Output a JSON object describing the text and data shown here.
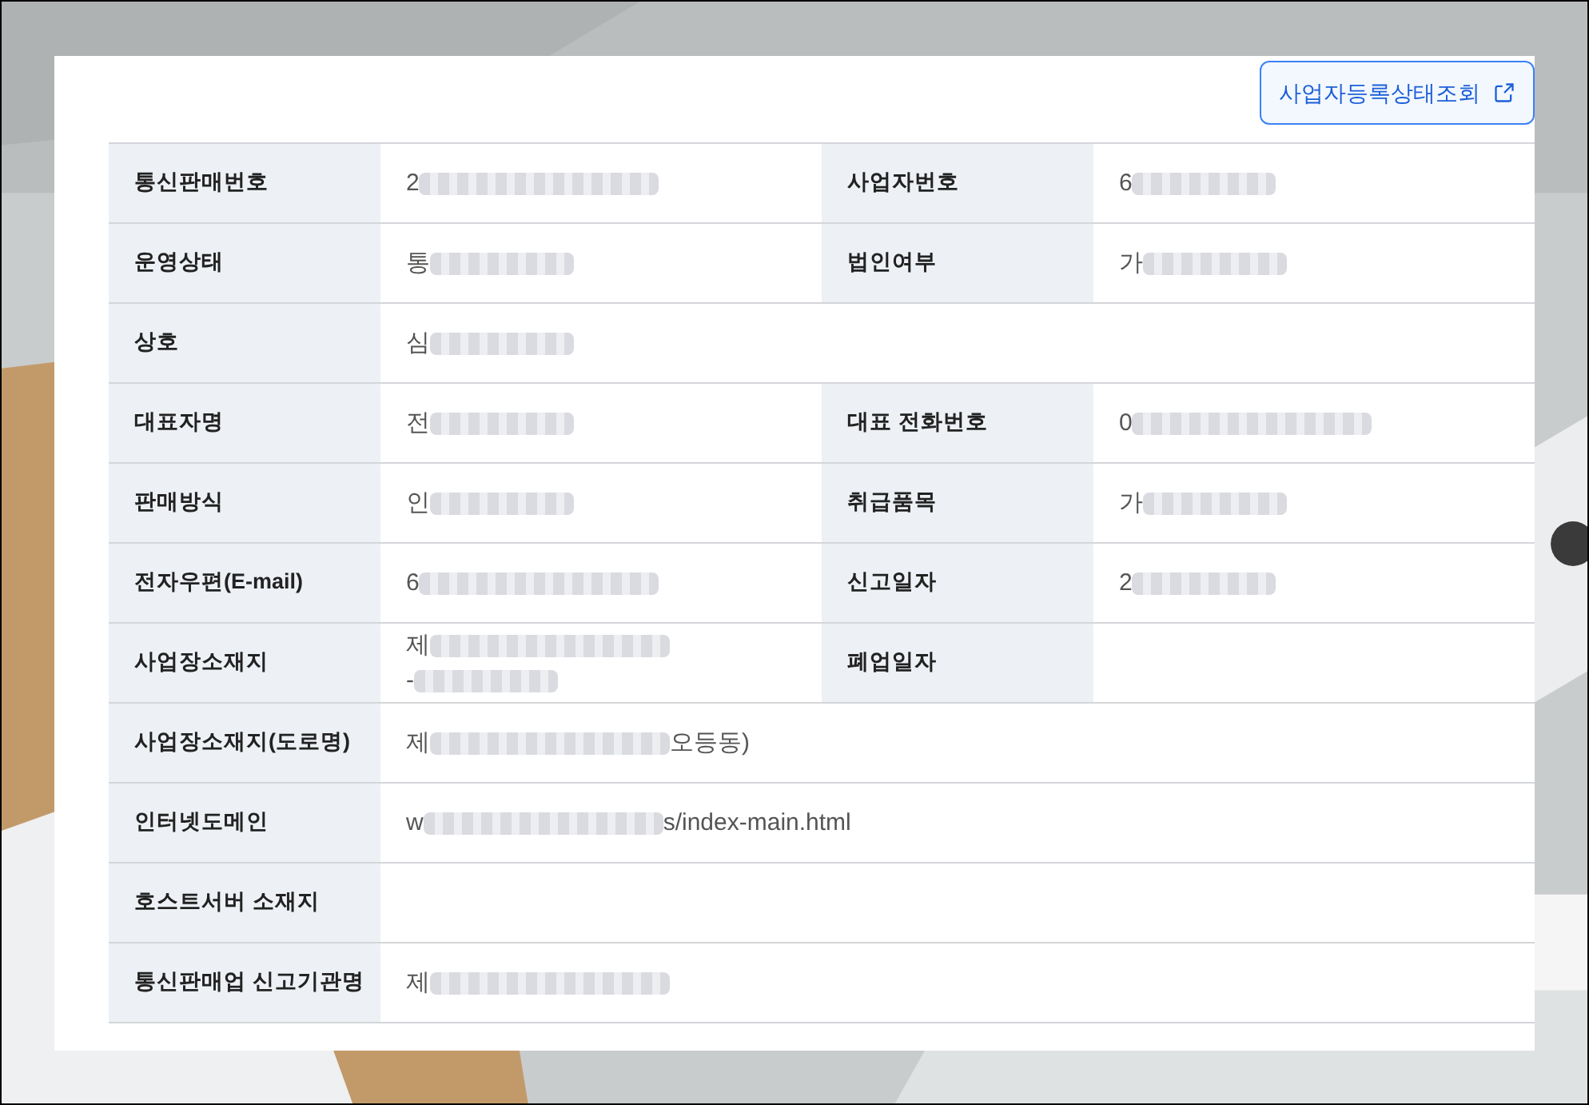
{
  "lookup_button": {
    "label": "사업자등록상태조회"
  },
  "rows": [
    {
      "cells": [
        {
          "label": "통신판매번호",
          "value": {
            "text": "2",
            "redacted": true,
            "long_redaction": true
          }
        },
        {
          "label": "사업자번호",
          "value": {
            "text": "6",
            "redacted": true,
            "long_redaction": false
          }
        }
      ]
    },
    {
      "cells": [
        {
          "label": "운영상태",
          "value": {
            "text": "통",
            "redacted": true,
            "long_redaction": false
          }
        },
        {
          "label": "법인여부",
          "value": {
            "text": "가",
            "redacted": true,
            "long_redaction": false
          }
        }
      ]
    },
    {
      "cells": [
        {
          "label": "상호",
          "value": {
            "text": "심",
            "redacted": true,
            "long_redaction": false
          }
        }
      ]
    },
    {
      "cells": [
        {
          "label": "대표자명",
          "value": {
            "text": "전",
            "redacted": true,
            "long_redaction": false
          }
        },
        {
          "label": "대표 전화번호",
          "value": {
            "text": "0",
            "redacted": true,
            "long_redaction": true
          }
        }
      ]
    },
    {
      "cells": [
        {
          "label": "판매방식",
          "value": {
            "text": "인",
            "redacted": true,
            "long_redaction": false
          }
        },
        {
          "label": "취급품목",
          "value": {
            "text": "가",
            "redacted": true,
            "long_redaction": false
          }
        }
      ]
    },
    {
      "cells": [
        {
          "label": "전자우편(E-mail)",
          "value": {
            "text": "6",
            "redacted": true,
            "long_redaction": true
          }
        },
        {
          "label": "신고일자",
          "value": {
            "text": "2",
            "redacted": true,
            "long_redaction": false
          }
        }
      ]
    },
    {
      "cells": [
        {
          "label": "사업장소재지",
          "value": {
            "text": "제",
            "redacted": true,
            "long_redaction": true,
            "line2": {
              "text": "-",
              "redacted": true,
              "long_redaction": false
            }
          }
        },
        {
          "label": "폐업일자"
        }
      ]
    },
    {
      "cells": [
        {
          "label": "사업장소재지(도로명)",
          "value": {
            "text": "제",
            "redacted": true,
            "long_redaction": true,
            "after": "오등동)"
          }
        }
      ]
    },
    {
      "cells": [
        {
          "label": "인터넷도메인",
          "value": {
            "text": "w",
            "redacted": true,
            "long_redaction": true,
            "after": "s/index-main.html"
          }
        }
      ]
    },
    {
      "cells": [
        {
          "label": "호스트서버 소재지"
        }
      ]
    },
    {
      "cells": [
        {
          "label": "통신판매업 신고기관명",
          "value": {
            "text": "제",
            "redacted": true,
            "long_redaction": true
          }
        }
      ]
    }
  ]
}
